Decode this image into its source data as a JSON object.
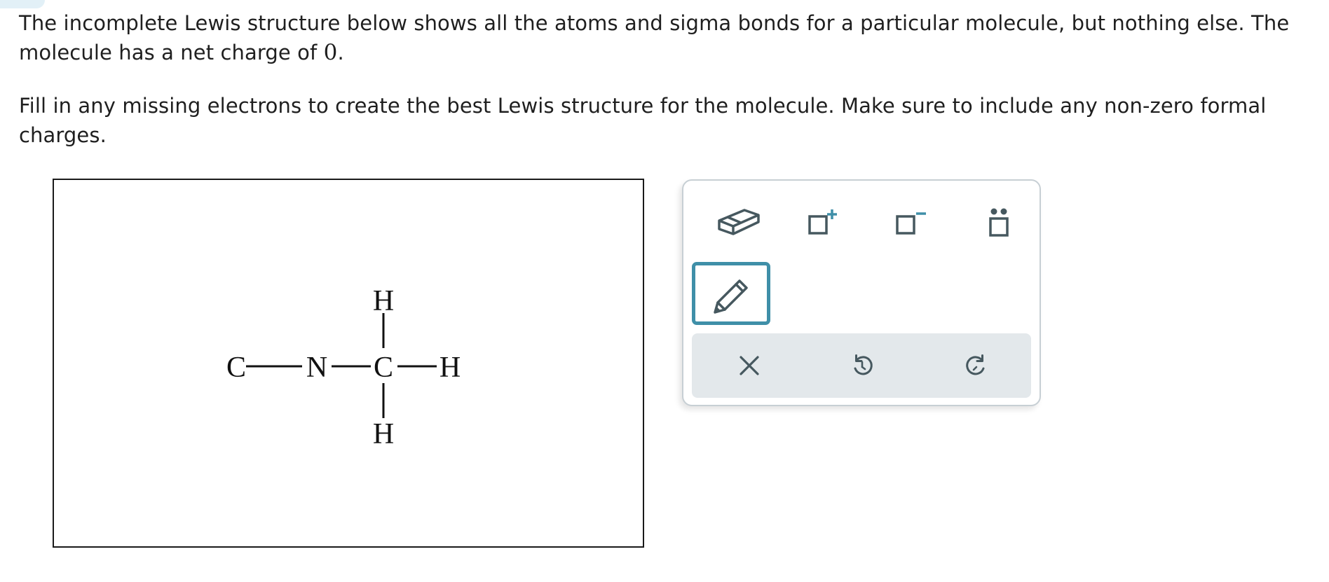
{
  "prompt": {
    "para1_before": "The incomplete Lewis structure below shows all the atoms and sigma bonds for a particular molecule, but nothing else. The molecule has a net charge of ",
    "net_charge": "0",
    "para1_after": ".",
    "para2": "Fill in any missing electrons to create the best Lewis structure for the molecule. Make sure to include any non-zero formal charges."
  },
  "molecule": {
    "atoms": {
      "c_left": "C",
      "n": "N",
      "c_center": "C",
      "h_top": "H",
      "h_right": "H",
      "h_bottom": "H"
    }
  },
  "toolbox": {
    "tools": [
      {
        "id": "eraser",
        "icon": "eraser-icon",
        "selected": false
      },
      {
        "id": "positive-charge",
        "icon": "positive-charge-icon",
        "symbol": "+",
        "selected": false
      },
      {
        "id": "negative-charge",
        "icon": "negative-charge-icon",
        "symbol": "−",
        "selected": false
      },
      {
        "id": "lone-pair",
        "icon": "lone-pair-icon",
        "selected": false
      },
      {
        "id": "pencil",
        "icon": "pencil-icon",
        "selected": true
      }
    ],
    "actions": [
      {
        "id": "clear",
        "icon": "close-icon"
      },
      {
        "id": "undo",
        "icon": "undo-icon"
      },
      {
        "id": "redo",
        "icon": "redo-icon"
      }
    ]
  },
  "colors": {
    "accent": "#3f8fa8",
    "icon": "#46585f",
    "action_bar": "#e3e8eb"
  }
}
